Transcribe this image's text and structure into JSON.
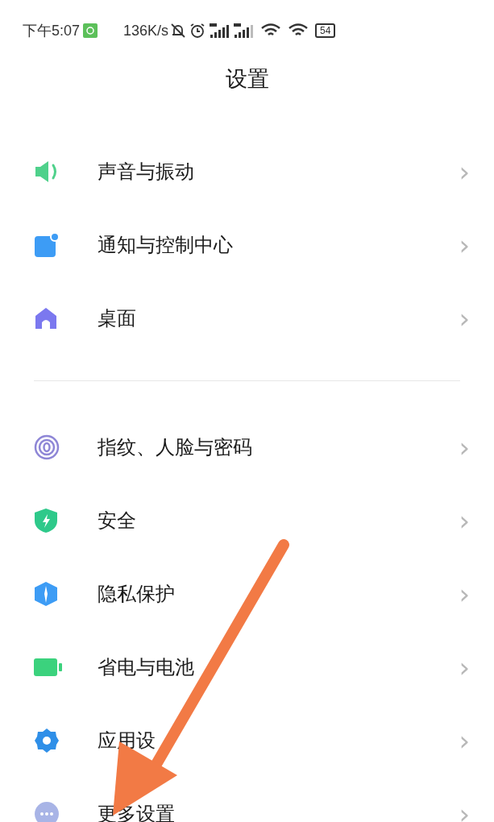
{
  "status_bar": {
    "time": "下午5:07",
    "speed": "136K/s",
    "battery": "54"
  },
  "title": "设置",
  "groups": [
    {
      "items": [
        {
          "label": "声音与振动",
          "chevron": "›"
        },
        {
          "label": "通知与控制中心",
          "chevron": "›"
        },
        {
          "label": "桌面",
          "chevron": "›"
        }
      ]
    },
    {
      "items": [
        {
          "label": "指纹、人脸与密码",
          "chevron": "›"
        },
        {
          "label": "安全",
          "chevron": "›"
        },
        {
          "label": "隐私保护",
          "chevron": "›"
        },
        {
          "label": "省电与电池",
          "chevron": "›"
        },
        {
          "label": "应用设",
          "chevron": "›"
        },
        {
          "label": "更多设置",
          "chevron": "›"
        }
      ]
    }
  ]
}
